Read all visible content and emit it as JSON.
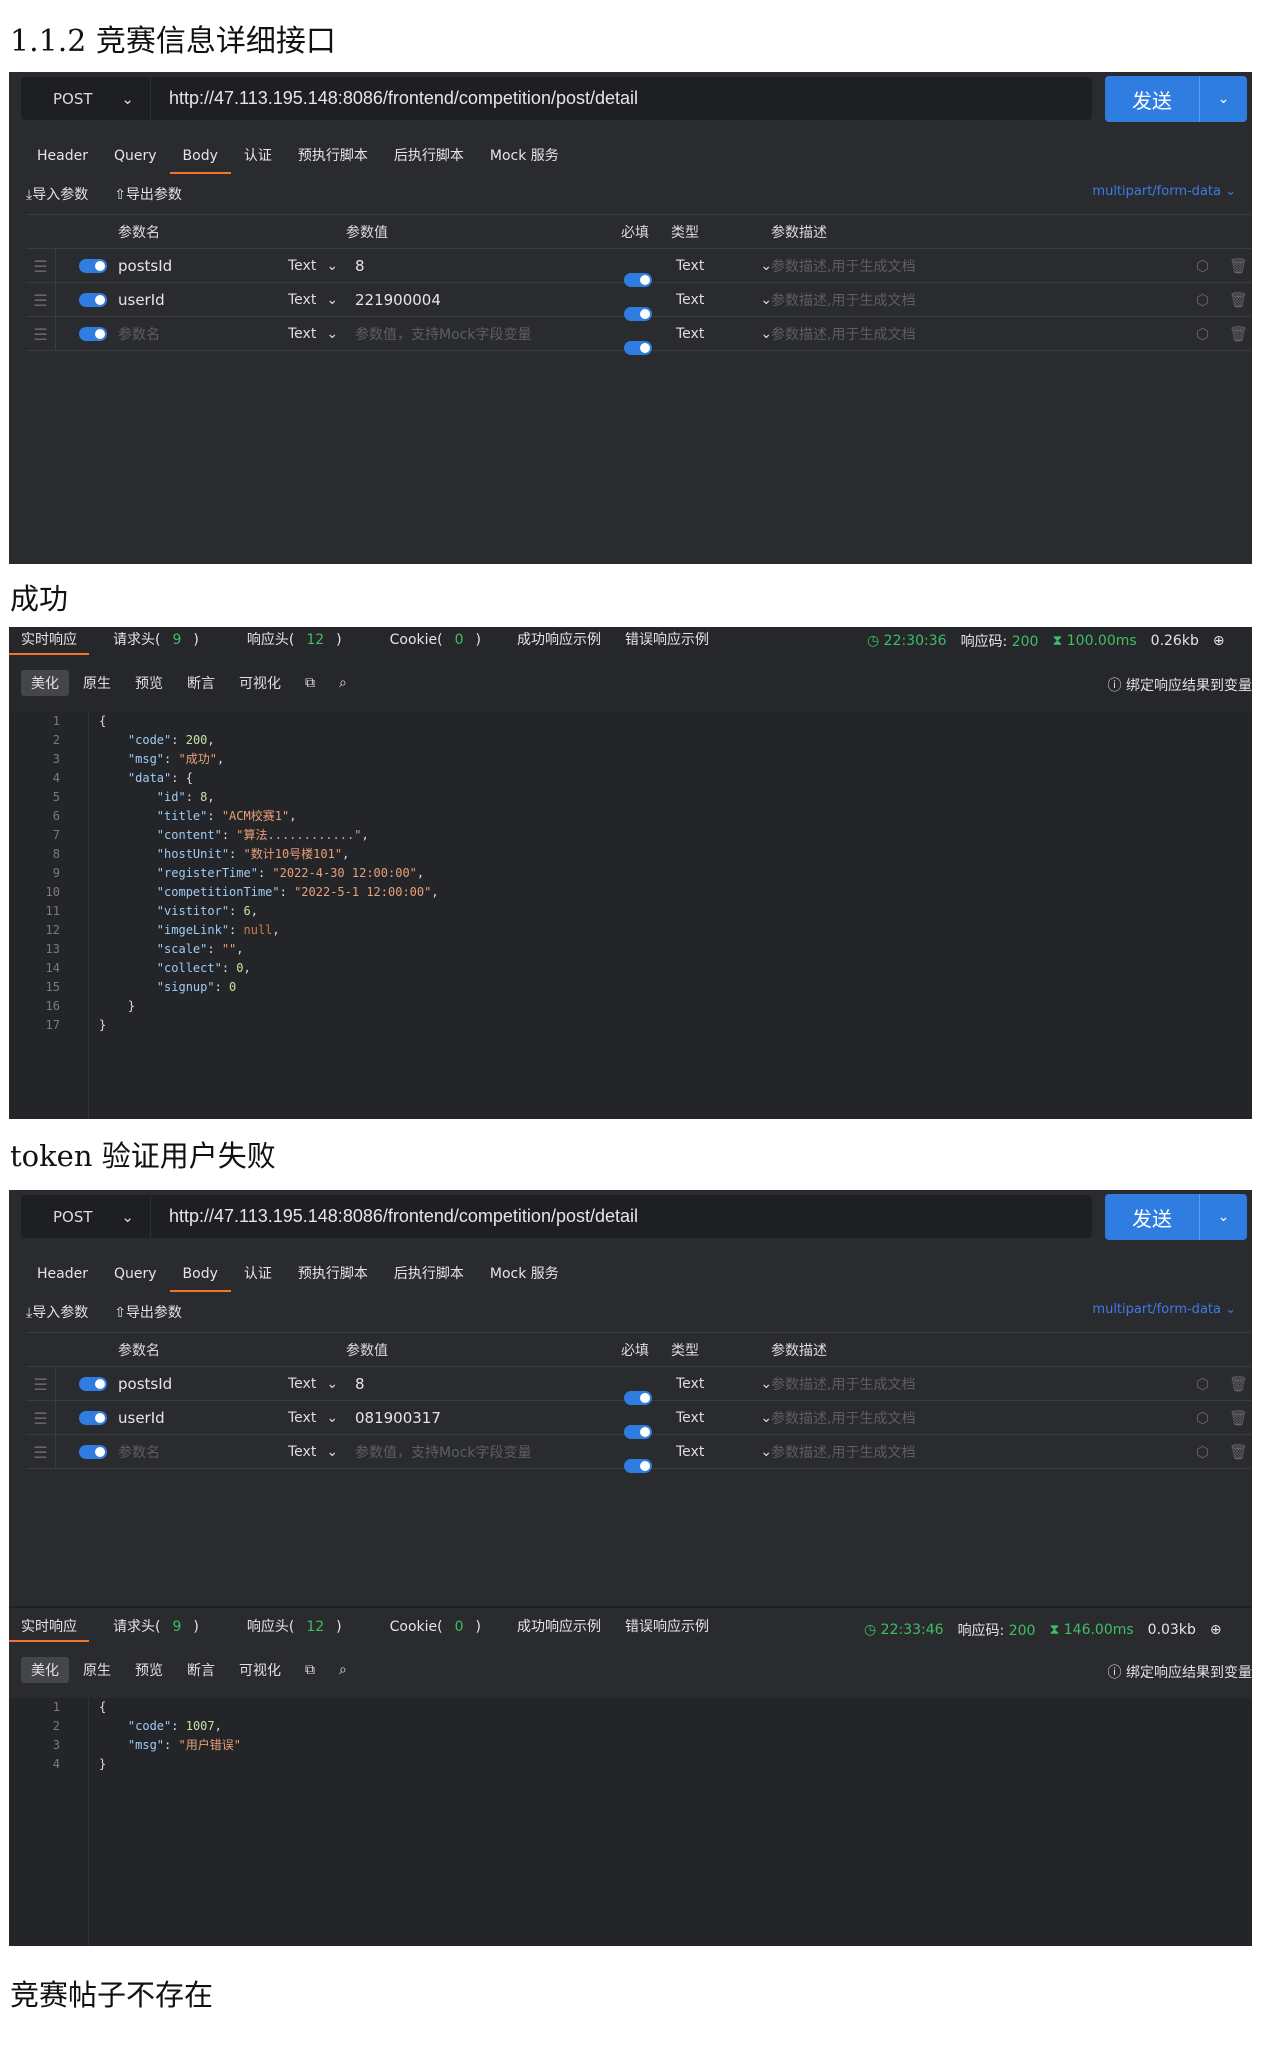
{
  "h1": "1.1.2 竞赛信息详细接口",
  "h2": "成功",
  "h3": "token 验证用户失败",
  "h4": "竞赛帖子不存在",
  "req": {
    "method": "POST",
    "url": "http://47.113.195.148:8086/frontend/competition/post/detail",
    "send": "发送",
    "tabs": [
      "Header",
      "Query",
      "Body",
      "认证",
      "预执行脚本",
      "后执行脚本",
      "Mock 服务"
    ],
    "import": "导入参数",
    "export": "导出参数",
    "content_type": "multipart/form-data",
    "cols": {
      "name": "参数名",
      "value": "参数值",
      "required": "必填",
      "type": "类型",
      "desc": "参数描述"
    },
    "type_text": "Text",
    "name_ph": "参数名",
    "value_ph": "参数值，支持Mock字段变量",
    "desc_ph": "参数描述,用于生成文档"
  },
  "req1": {
    "row1": {
      "name": "postsId",
      "value": "8"
    },
    "row2": {
      "name": "userId",
      "value": "221900004"
    }
  },
  "req2": {
    "row1": {
      "name": "postsId",
      "value": "8"
    },
    "row2": {
      "name": "userId",
      "value": "081900317"
    }
  },
  "resp": {
    "tabs": [
      "实时响应",
      "请求头(",
      "响应头(",
      "Cookie(",
      "成功响应示例",
      "错误响应示例"
    ],
    "req_count": "9",
    "resp_count": "12",
    "cookie_count": "0",
    "close": ")",
    "code_label": "响应码:",
    "views": [
      "美化",
      "原生",
      "预览",
      "断言",
      "可视化"
    ],
    "bind": "绑定响应结果到变量"
  },
  "resp1": {
    "time": "22:30:36",
    "code": "200",
    "duration": "100.00ms",
    "size": "0.26kb"
  },
  "resp2": {
    "time": "22:33:46",
    "code": "200",
    "duration": "146.00ms",
    "size": "0.03kb"
  }
}
